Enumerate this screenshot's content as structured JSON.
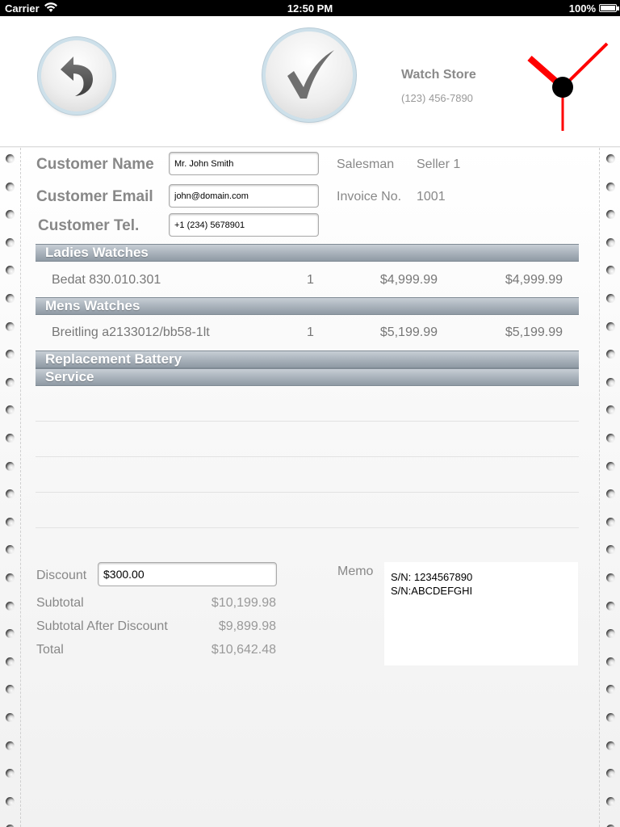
{
  "status_bar": {
    "carrier": "Carrier",
    "time": "12:50 PM",
    "battery": "100%"
  },
  "header": {
    "back_icon": "undo-arrow-icon",
    "confirm_icon": "checkmark-icon",
    "store_name": "Watch Store",
    "store_phone": "(123) 456-7890",
    "clock_icon": "clock-icon",
    "clock_colors": {
      "hands": "#ff0000",
      "hub": "#000000"
    }
  },
  "customer": {
    "name_label": "Customer Name",
    "name_value": "Mr. John Smith",
    "email_label": "Customer Email",
    "email_value": "john@domain.com",
    "tel_label": "Customer Tel.",
    "tel_value": "+1 (234) 5678901"
  },
  "invoice_info": {
    "salesman_label": "Salesman",
    "salesman_value": "Seller 1",
    "invoice_label": "Invoice No.",
    "invoice_value": "1001"
  },
  "sections": [
    {
      "title": "Ladies Watches",
      "items": [
        {
          "name": "Bedat 830.010.301",
          "qty": "1",
          "price": "$4,999.99",
          "total": "$4,999.99"
        }
      ]
    },
    {
      "title": "Mens Watches",
      "items": [
        {
          "name": "Breitling a2133012/bb58-1lt",
          "qty": "1",
          "price": "$5,199.99",
          "total": "$5,199.99"
        }
      ]
    },
    {
      "title": "Replacement Battery",
      "items": []
    },
    {
      "title": "Service",
      "items": []
    }
  ],
  "summary": {
    "discount_label": "Discount",
    "discount_value": "$300.00",
    "subtotal_label": "Subtotal",
    "subtotal_value": "$10,199.98",
    "after_discount_label": "Subtotal After Discount",
    "after_discount_value": "$9,899.98",
    "total_label": "Total",
    "total_value": "$10,642.48"
  },
  "memo": {
    "label": "Memo",
    "line1": "S/N: 1234567890",
    "line2": "S/N:ABCDEFGHI"
  },
  "colors": {
    "section_header": "#a3adb6",
    "status_bar": "#000000",
    "button_ring": "#cde0ea"
  }
}
